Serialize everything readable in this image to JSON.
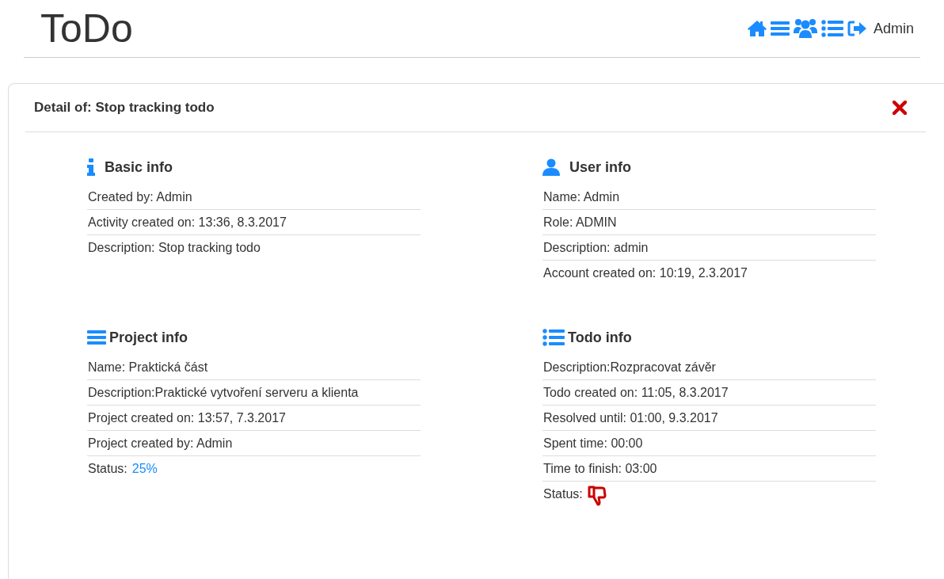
{
  "header": {
    "title": "ToDo",
    "user": "Admin"
  },
  "detail": {
    "title": "Detail of: Stop tracking todo",
    "sections": [
      {
        "title": "Basic info",
        "rows": [
          {
            "kind": "text",
            "text": "Created by: Admin"
          },
          {
            "kind": "text",
            "text": "Activity created on: 13:36, 8.3.2017"
          },
          {
            "kind": "text",
            "text": "Description: Stop tracking todo"
          }
        ]
      },
      {
        "title": "User info",
        "rows": [
          {
            "kind": "text",
            "text": "Name: Admin"
          },
          {
            "kind": "text",
            "text": "Role: ADMIN"
          },
          {
            "kind": "text",
            "text": "Description: admin"
          },
          {
            "kind": "text",
            "text": "Account created on: 10:19, 2.3.2017"
          }
        ]
      },
      {
        "title": "Project info",
        "rows": [
          {
            "kind": "text",
            "text": "Name: Praktická část"
          },
          {
            "kind": "text",
            "text": "Description:Praktické vytvoření serveru a klienta"
          },
          {
            "kind": "text",
            "text": "Project created on: 13:57, 7.3.2017"
          },
          {
            "kind": "text",
            "text": "Project created by: Admin"
          },
          {
            "kind": "percent",
            "text": "Status:",
            "value": "25%"
          }
        ]
      },
      {
        "title": "Todo info",
        "rows": [
          {
            "kind": "text",
            "text": "Description:Rozpracovat závěr"
          },
          {
            "kind": "text",
            "text": "Todo created on: 11:05, 8.3.2017"
          },
          {
            "kind": "text",
            "text": "Resolved until: 01:00, 9.3.2017"
          },
          {
            "kind": "text",
            "text": "Spent time: 00:00"
          },
          {
            "kind": "text",
            "text": "Time to finish: 03:00"
          },
          {
            "kind": "thumb",
            "text": "Status:",
            "resolved": false
          }
        ]
      }
    ]
  }
}
